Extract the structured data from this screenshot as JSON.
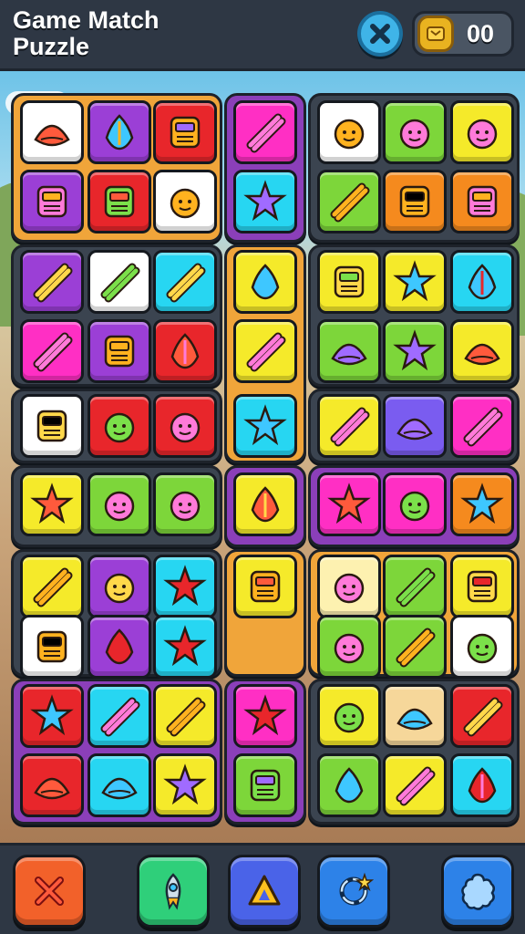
{
  "header": {
    "title": "Game Match Puzzle",
    "coin_count": "00",
    "close_icon": "close-x-icon",
    "coin_icon": "coin-icon"
  },
  "colors": {
    "header_bg": "#2e3744",
    "close_button": "#3fb4e8",
    "coin": "#e9b320"
  },
  "groups": [
    {
      "name": "group-top-left",
      "color": "#f0a53a"
    },
    {
      "name": "group-top-middle",
      "color": "#8b3fb9"
    },
    {
      "name": "group-top-right",
      "color": "#3b4450"
    },
    {
      "name": "group-row2-left",
      "color": "#3b4450"
    },
    {
      "name": "group-row2-middle",
      "color": "#f0a53a"
    },
    {
      "name": "group-row2-right",
      "color": "#3b4450"
    },
    {
      "name": "group-row3-left",
      "color": "#3b4450"
    },
    {
      "name": "group-row3-right",
      "color": "#3b4450"
    },
    {
      "name": "group-row4-left",
      "color": "#3b4450"
    },
    {
      "name": "group-row4-right",
      "color": "#8b3fb9"
    },
    {
      "name": "group-row5-left",
      "color": "#3b4450"
    },
    {
      "name": "group-row5-middle",
      "color": "#f0a53a"
    },
    {
      "name": "group-row5-right",
      "color": "#f0a53a"
    },
    {
      "name": "group-bottom-left",
      "color": "#8b3fb9"
    },
    {
      "name": "group-bottom-middle",
      "color": "#8b3fb9"
    },
    {
      "name": "group-bottom-right",
      "color": "#3b4450"
    }
  ],
  "tiles": [
    {
      "icon": "bell-dome-icon",
      "bg": "#ffffff"
    },
    {
      "icon": "carrot-icon",
      "bg": "#9b3fd6"
    },
    {
      "icon": "sun-face-icon",
      "bg": "#e8262b"
    },
    {
      "icon": "banana-bowl-icon",
      "bg": "#ff2fc4"
    },
    {
      "icon": "cloud-tree-icon",
      "bg": "#ffffff"
    },
    {
      "icon": "pumpkin-face-icon",
      "bg": "#7dd63a"
    },
    {
      "icon": "green-sun-icon",
      "bg": "#f5ea2a"
    },
    {
      "icon": "crossed-carrots-icon",
      "bg": "#9b3fd6"
    },
    {
      "icon": "ghost-leaf-icon",
      "bg": "#e8262b"
    },
    {
      "icon": "salad-bowl-icon",
      "bg": "#ffffff"
    },
    {
      "icon": "orange-star-icon",
      "bg": "#27d6f2"
    },
    {
      "icon": "bear-face-icon",
      "bg": "#7dd63a"
    },
    {
      "icon": "chili-pepper-icon",
      "bg": "#f58a1e"
    },
    {
      "icon": "celery-icon",
      "bg": "#f58a1e"
    },
    {
      "icon": "robot-box-icon",
      "bg": "#9b3fd6"
    },
    {
      "icon": "toaster-icon",
      "bg": "#ffffff"
    },
    {
      "icon": "fish-icon",
      "bg": "#27d6f2"
    },
    {
      "icon": "radio-icon",
      "bg": "#f5ea2a"
    },
    {
      "icon": "crab-icon",
      "bg": "#f5ea2a"
    },
    {
      "icon": "wheel-icon",
      "bg": "#f5ea2a"
    },
    {
      "icon": "octopus-face-icon",
      "bg": "#27d6f2"
    },
    {
      "icon": "crossed-bread-icon",
      "bg": "#ff2fc4"
    },
    {
      "icon": "pinwheel-icon",
      "bg": "#9b3fd6"
    },
    {
      "icon": "knife-icon",
      "bg": "#e8262b"
    },
    {
      "icon": "squid-icon",
      "bg": "#f5ea2a"
    },
    {
      "icon": "tomato-bug-icon",
      "bg": "#7dd63a"
    },
    {
      "icon": "radish-icon",
      "bg": "#7dd63a"
    },
    {
      "icon": "mushroom-robot-icon",
      "bg": "#f5ea2a"
    },
    {
      "icon": "mushroom-icon",
      "bg": "#ffffff"
    },
    {
      "icon": "smiling-sun-icon",
      "bg": "#e8262b"
    },
    {
      "icon": "pineapple-icon",
      "bg": "#e8262b"
    },
    {
      "icon": "alien-face-icon",
      "bg": "#27d6f2"
    },
    {
      "icon": "beet-icon",
      "bg": "#f5ea2a"
    },
    {
      "icon": "whale-icon",
      "bg": "#7a5cf0"
    },
    {
      "icon": "pepper-icon",
      "bg": "#ff2fc4"
    },
    {
      "icon": "crossed-sausage-icon",
      "bg": "#f5ea2a"
    },
    {
      "icon": "papaya-icon",
      "bg": "#7dd63a"
    },
    {
      "icon": "marker-icon",
      "bg": "#7dd63a"
    },
    {
      "icon": "fire-leaf-icon",
      "bg": "#f5ea2a"
    },
    {
      "icon": "pink-sun-icon",
      "bg": "#ff2fc4"
    },
    {
      "icon": "pink-face-icon",
      "bg": "#ff2fc4"
    },
    {
      "icon": "phone-robot-icon",
      "bg": "#f58a1e"
    },
    {
      "icon": "lettuce-icon",
      "bg": "#f5ea2a"
    },
    {
      "icon": "pumpkin-icon",
      "bg": "#9b3fd6"
    },
    {
      "icon": "shrimp-icon",
      "bg": "#27d6f2"
    },
    {
      "icon": "leaf-icon",
      "bg": "#f5ea2a"
    },
    {
      "icon": "mushroom-tall-icon",
      "bg": "#fdf1b0"
    },
    {
      "icon": "potted-plant-icon",
      "bg": "#7dd63a"
    },
    {
      "icon": "green-leaf-icon",
      "bg": "#f5ea2a"
    },
    {
      "icon": "red-star-icon",
      "bg": "#ffffff"
    },
    {
      "icon": "bent-carrot-icon",
      "bg": "#9b3fd6"
    },
    {
      "icon": "fish-fillet-icon",
      "bg": "#27d6f2"
    },
    {
      "icon": "tomato-icon",
      "bg": "#7dd63a"
    },
    {
      "icon": "cucumber-icon",
      "bg": "#7dd63a"
    },
    {
      "icon": "green-shirt-icon",
      "bg": "#ffffff"
    },
    {
      "icon": "jar-icon",
      "bg": "#e8262b"
    },
    {
      "icon": "apple-icon",
      "bg": "#27d6f2"
    },
    {
      "icon": "maple-leaf-icon",
      "bg": "#f5ea2a"
    },
    {
      "icon": "blue-bow-icon",
      "bg": "#ff2fc4"
    },
    {
      "icon": "orange-face-icon",
      "bg": "#f5ea2a"
    },
    {
      "icon": "orange-slice-icon",
      "bg": "#f6d79a"
    },
    {
      "icon": "red-bug-icon",
      "bg": "#e8262b"
    },
    {
      "icon": "mushroom-cap-icon",
      "bg": "#e8262b"
    },
    {
      "icon": "melon-seed-icon",
      "bg": "#27d6f2"
    },
    {
      "icon": "palm-leaf-icon",
      "bg": "#f5ea2a"
    },
    {
      "icon": "green-palm-icon",
      "bg": "#7dd63a"
    },
    {
      "icon": "blue-fish-icon",
      "bg": "#7dd63a"
    },
    {
      "icon": "pink-flower-icon",
      "bg": "#f5ea2a"
    },
    {
      "icon": "octopus-icon",
      "bg": "#27d6f2"
    }
  ],
  "bottom_bar": [
    {
      "name": "cancel-button",
      "icon": "close-x-icon",
      "bg": "#f2612a"
    },
    {
      "name": "rocket-button",
      "icon": "rocket-icon",
      "bg": "#2fcf7a"
    },
    {
      "name": "hint-button",
      "icon": "arrow-up-icon",
      "bg": "#4a63e8"
    },
    {
      "name": "shuffle-button",
      "icon": "shuffle-star-icon",
      "bg": "#2d82e8"
    },
    {
      "name": "menu-button",
      "icon": "flower-badge-icon",
      "bg": "#2d82e8"
    }
  ]
}
